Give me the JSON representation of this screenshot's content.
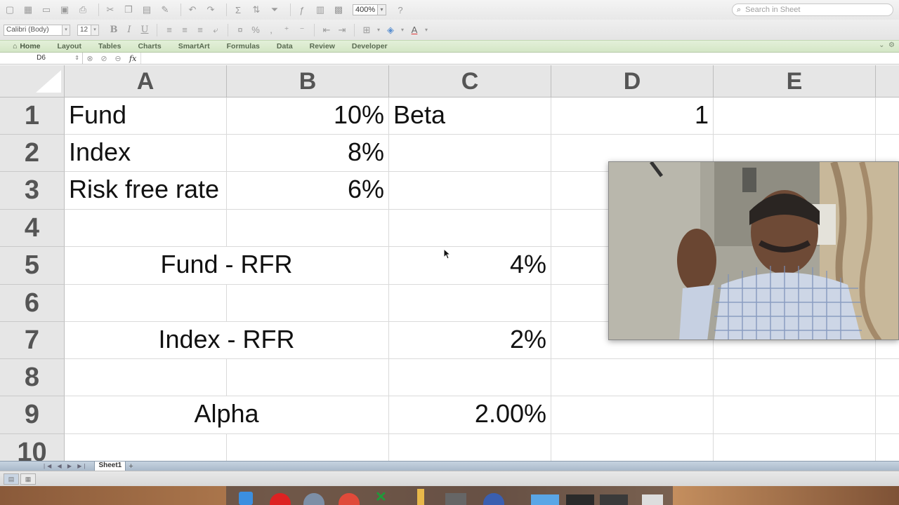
{
  "toolbar": {
    "zoom": "400%",
    "search_placeholder": "Search in Sheet"
  },
  "format_bar": {
    "font_name": "Calibri (Body)",
    "font_size": "12",
    "bold": "B",
    "italic": "I",
    "underline": "U",
    "percent": "%",
    "comma": ",",
    "font_color_glyph": "A"
  },
  "ribbon": {
    "tabs": [
      "Home",
      "Layout",
      "Tables",
      "Charts",
      "SmartArt",
      "Formulas",
      "Data",
      "Review",
      "Developer"
    ]
  },
  "formula_bar": {
    "name_box": "D6",
    "fx": "fx",
    "content": ""
  },
  "sheet": {
    "columns": [
      "A",
      "B",
      "C",
      "D",
      "E"
    ],
    "rows": [
      "1",
      "2",
      "3",
      "4",
      "5",
      "6",
      "7",
      "8",
      "9",
      "10"
    ],
    "cells": {
      "A1": "Fund",
      "B1": "10%",
      "C1": "Beta",
      "D1": "1",
      "A2": "Index",
      "B2": "8%",
      "A3": "Risk free rate",
      "B3": "6%",
      "AB5": "Fund - RFR",
      "C5": "4%",
      "AB7": "Index - RFR",
      "C7": "2%",
      "AB9": "Alpha",
      "C9": "2.00%"
    }
  },
  "sheet_tabs": {
    "nav": "|◀ ◀ ▶ ▶|",
    "active": "Sheet1",
    "add": "+"
  },
  "colors": {
    "ribbon_green": "#d4e6c6",
    "header_gray": "#e6e6e6",
    "sheetbar_blue": "#a9b9ca"
  }
}
